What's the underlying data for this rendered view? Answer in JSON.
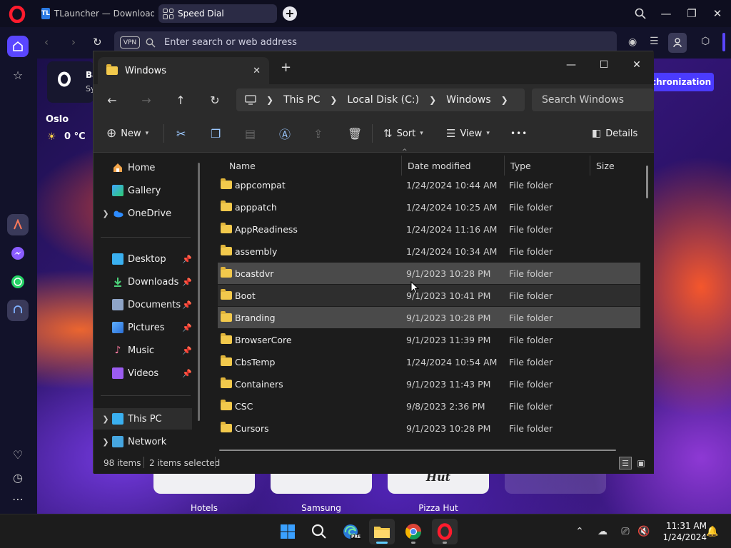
{
  "browser": {
    "tabs": [
      {
        "label": "TLauncher — Download M",
        "favicon": "TL"
      },
      {
        "label": "Speed Dial"
      }
    ],
    "address_placeholder": "Enter search or web address",
    "vpn_label": "VPN",
    "sync_button": "chronization",
    "weather": {
      "city": "Oslo",
      "temp": "0 °C"
    },
    "bookmark_snippet": {
      "line1": "Ba",
      "line2": "Sy"
    },
    "speed_dial": [
      {
        "label": "Hotels"
      },
      {
        "label": "Samsung"
      },
      {
        "label": "Pizza Hut",
        "card_text": "Hut"
      }
    ]
  },
  "explorer": {
    "window_title": "Windows",
    "breadcrumb": [
      "This PC",
      "Local Disk (C:)",
      "Windows"
    ],
    "search_placeholder": "Search Windows",
    "toolbar": {
      "new_label": "New",
      "sort_label": "Sort",
      "view_label": "View",
      "more_label": "•••",
      "details_label": "Details"
    },
    "nav_pane": {
      "top": [
        {
          "label": "Home",
          "icon": "home-icon"
        },
        {
          "label": "Gallery",
          "icon": "gallery-icon"
        },
        {
          "label": "OneDrive",
          "icon": "onedrive-icon",
          "expandable": true
        }
      ],
      "pinned": [
        {
          "label": "Desktop",
          "icon": "desktop-icon"
        },
        {
          "label": "Downloads",
          "icon": "downloads-icon"
        },
        {
          "label": "Documents",
          "icon": "documents-icon"
        },
        {
          "label": "Pictures",
          "icon": "pictures-icon"
        },
        {
          "label": "Music",
          "icon": "music-icon"
        },
        {
          "label": "Videos",
          "icon": "videos-icon"
        }
      ],
      "bottom": [
        {
          "label": "This PC",
          "icon": "this-pc-icon",
          "expandable": true,
          "selected": true
        },
        {
          "label": "Network",
          "icon": "network-icon",
          "expandable": true
        }
      ]
    },
    "columns": [
      "Name",
      "Date modified",
      "Type",
      "Size"
    ],
    "rows": [
      {
        "name": "appcompat",
        "date": "1/24/2024 10:44 AM",
        "type": "File folder",
        "selected": false
      },
      {
        "name": "apppatch",
        "date": "1/24/2024 10:25 AM",
        "type": "File folder",
        "selected": false
      },
      {
        "name": "AppReadiness",
        "date": "1/24/2024 11:16 AM",
        "type": "File folder",
        "selected": false
      },
      {
        "name": "assembly",
        "date": "1/24/2024 10:34 AM",
        "type": "File folder",
        "selected": false
      },
      {
        "name": "bcastdvr",
        "date": "9/1/2023 10:28 PM",
        "type": "File folder",
        "selected": true
      },
      {
        "name": "Boot",
        "date": "9/1/2023 10:41 PM",
        "type": "File folder",
        "selected": false,
        "hover": true
      },
      {
        "name": "Branding",
        "date": "9/1/2023 10:28 PM",
        "type": "File folder",
        "selected": true
      },
      {
        "name": "BrowserCore",
        "date": "9/1/2023 11:39 PM",
        "type": "File folder",
        "selected": false
      },
      {
        "name": "CbsTemp",
        "date": "1/24/2024 10:54 AM",
        "type": "File folder",
        "selected": false
      },
      {
        "name": "Containers",
        "date": "9/1/2023 11:43 PM",
        "type": "File folder",
        "selected": false
      },
      {
        "name": "CSC",
        "date": "9/8/2023 2:36 PM",
        "type": "File folder",
        "selected": false
      },
      {
        "name": "Cursors",
        "date": "9/1/2023 10:28 PM",
        "type": "File folder",
        "selected": false
      }
    ],
    "status": {
      "items": "98 items",
      "selected": "2 items selected"
    }
  },
  "taskbar": {
    "apps": [
      "start-icon",
      "search-icon",
      "edge-preview-icon",
      "file-explorer-icon",
      "chrome-icon",
      "opera-icon"
    ],
    "clock": {
      "time": "11:31 AM",
      "date": "1/24/2024"
    },
    "edge_badge": "PRE"
  }
}
